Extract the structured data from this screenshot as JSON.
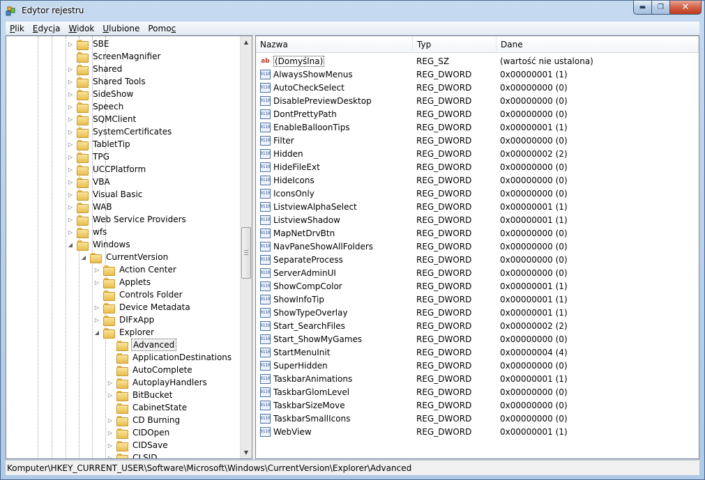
{
  "window": {
    "title": "Edytor rejestru"
  },
  "menu": [
    {
      "pre": "",
      "u": "P",
      "post": "lik"
    },
    {
      "pre": "",
      "u": "E",
      "post": "dycja"
    },
    {
      "pre": "",
      "u": "W",
      "post": "idok"
    },
    {
      "pre": "",
      "u": "U",
      "post": "lubione"
    },
    {
      "pre": "Pomo",
      "u": "c",
      "post": ""
    }
  ],
  "tree": {
    "items": [
      {
        "label": "SBE",
        "level": 1,
        "exp": "collapsed"
      },
      {
        "label": "ScreenMagnifier",
        "level": 1,
        "exp": "none"
      },
      {
        "label": "Shared",
        "level": 1,
        "exp": "collapsed"
      },
      {
        "label": "Shared Tools",
        "level": 1,
        "exp": "collapsed"
      },
      {
        "label": "SideShow",
        "level": 1,
        "exp": "collapsed"
      },
      {
        "label": "Speech",
        "level": 1,
        "exp": "collapsed"
      },
      {
        "label": "SQMClient",
        "level": 1,
        "exp": "collapsed"
      },
      {
        "label": "SystemCertificates",
        "level": 1,
        "exp": "collapsed"
      },
      {
        "label": "TabletTip",
        "level": 1,
        "exp": "collapsed"
      },
      {
        "label": "TPG",
        "level": 1,
        "exp": "collapsed"
      },
      {
        "label": "UCCPlatform",
        "level": 1,
        "exp": "collapsed"
      },
      {
        "label": "VBA",
        "level": 1,
        "exp": "collapsed"
      },
      {
        "label": "Visual Basic",
        "level": 1,
        "exp": "collapsed"
      },
      {
        "label": "WAB",
        "level": 1,
        "exp": "collapsed"
      },
      {
        "label": "Web Service Providers",
        "level": 1,
        "exp": "collapsed"
      },
      {
        "label": "wfs",
        "level": 1,
        "exp": "collapsed"
      },
      {
        "label": "Windows",
        "level": 1,
        "exp": "expanded"
      },
      {
        "label": "CurrentVersion",
        "level": 2,
        "exp": "expanded"
      },
      {
        "label": "Action Center",
        "level": 3,
        "exp": "collapsed"
      },
      {
        "label": "Applets",
        "level": 3,
        "exp": "collapsed"
      },
      {
        "label": "Controls Folder",
        "level": 3,
        "exp": "none"
      },
      {
        "label": "Device Metadata",
        "level": 3,
        "exp": "collapsed"
      },
      {
        "label": "DIFxApp",
        "level": 3,
        "exp": "collapsed"
      },
      {
        "label": "Explorer",
        "level": 3,
        "exp": "expanded"
      },
      {
        "label": "Advanced",
        "level": 4,
        "exp": "none",
        "selected": true
      },
      {
        "label": "ApplicationDestinations",
        "level": 4,
        "exp": "none"
      },
      {
        "label": "AutoComplete",
        "level": 4,
        "exp": "none"
      },
      {
        "label": "AutoplayHandlers",
        "level": 4,
        "exp": "collapsed"
      },
      {
        "label": "BitBucket",
        "level": 4,
        "exp": "collapsed"
      },
      {
        "label": "CabinetState",
        "level": 4,
        "exp": "none"
      },
      {
        "label": "CD Burning",
        "level": 4,
        "exp": "collapsed"
      },
      {
        "label": "CIDOpen",
        "level": 4,
        "exp": "collapsed"
      },
      {
        "label": "CIDSave",
        "level": 4,
        "exp": "collapsed"
      },
      {
        "label": "CLSID",
        "level": 4,
        "exp": "collapsed"
      }
    ]
  },
  "columns": {
    "name": "Nazwa",
    "type": "Typ",
    "data": "Dane"
  },
  "values": [
    {
      "name": "(Domyślna)",
      "type": "REG_SZ",
      "data": "(wartość nie ustalona)",
      "icon": "string-value-icon"
    },
    {
      "name": "AlwaysShowMenus",
      "type": "REG_DWORD",
      "data": "0x00000001 (1)",
      "icon": "binary-value-icon"
    },
    {
      "name": "AutoCheckSelect",
      "type": "REG_DWORD",
      "data": "0x00000000 (0)",
      "icon": "binary-value-icon"
    },
    {
      "name": "DisablePreviewDesktop",
      "type": "REG_DWORD",
      "data": "0x00000000 (0)",
      "icon": "binary-value-icon"
    },
    {
      "name": "DontPrettyPath",
      "type": "REG_DWORD",
      "data": "0x00000000 (0)",
      "icon": "binary-value-icon"
    },
    {
      "name": "EnableBalloonTips",
      "type": "REG_DWORD",
      "data": "0x00000001 (1)",
      "icon": "binary-value-icon"
    },
    {
      "name": "Filter",
      "type": "REG_DWORD",
      "data": "0x00000000 (0)",
      "icon": "binary-value-icon"
    },
    {
      "name": "Hidden",
      "type": "REG_DWORD",
      "data": "0x00000002 (2)",
      "icon": "binary-value-icon"
    },
    {
      "name": "HideFileExt",
      "type": "REG_DWORD",
      "data": "0x00000000 (0)",
      "icon": "binary-value-icon"
    },
    {
      "name": "HideIcons",
      "type": "REG_DWORD",
      "data": "0x00000000 (0)",
      "icon": "binary-value-icon"
    },
    {
      "name": "IconsOnly",
      "type": "REG_DWORD",
      "data": "0x00000000 (0)",
      "icon": "binary-value-icon"
    },
    {
      "name": "ListviewAlphaSelect",
      "type": "REG_DWORD",
      "data": "0x00000001 (1)",
      "icon": "binary-value-icon"
    },
    {
      "name": "ListviewShadow",
      "type": "REG_DWORD",
      "data": "0x00000001 (1)",
      "icon": "binary-value-icon"
    },
    {
      "name": "MapNetDrvBtn",
      "type": "REG_DWORD",
      "data": "0x00000000 (0)",
      "icon": "binary-value-icon"
    },
    {
      "name": "NavPaneShowAllFolders",
      "type": "REG_DWORD",
      "data": "0x00000000 (0)",
      "icon": "binary-value-icon"
    },
    {
      "name": "SeparateProcess",
      "type": "REG_DWORD",
      "data": "0x00000000 (0)",
      "icon": "binary-value-icon"
    },
    {
      "name": "ServerAdminUI",
      "type": "REG_DWORD",
      "data": "0x00000000 (0)",
      "icon": "binary-value-icon"
    },
    {
      "name": "ShowCompColor",
      "type": "REG_DWORD",
      "data": "0x00000001 (1)",
      "icon": "binary-value-icon"
    },
    {
      "name": "ShowInfoTip",
      "type": "REG_DWORD",
      "data": "0x00000001 (1)",
      "icon": "binary-value-icon"
    },
    {
      "name": "ShowTypeOverlay",
      "type": "REG_DWORD",
      "data": "0x00000001 (1)",
      "icon": "binary-value-icon"
    },
    {
      "name": "Start_SearchFiles",
      "type": "REG_DWORD",
      "data": "0x00000002 (2)",
      "icon": "binary-value-icon"
    },
    {
      "name": "Start_ShowMyGames",
      "type": "REG_DWORD",
      "data": "0x00000000 (0)",
      "icon": "binary-value-icon"
    },
    {
      "name": "StartMenuInit",
      "type": "REG_DWORD",
      "data": "0x00000004 (4)",
      "icon": "binary-value-icon"
    },
    {
      "name": "SuperHidden",
      "type": "REG_DWORD",
      "data": "0x00000000 (0)",
      "icon": "binary-value-icon"
    },
    {
      "name": "TaskbarAnimations",
      "type": "REG_DWORD",
      "data": "0x00000001 (1)",
      "icon": "binary-value-icon"
    },
    {
      "name": "TaskbarGlomLevel",
      "type": "REG_DWORD",
      "data": "0x00000000 (0)",
      "icon": "binary-value-icon"
    },
    {
      "name": "TaskbarSizeMove",
      "type": "REG_DWORD",
      "data": "0x00000000 (0)",
      "icon": "binary-value-icon"
    },
    {
      "name": "TaskbarSmallIcons",
      "type": "REG_DWORD",
      "data": "0x00000000 (0)",
      "icon": "binary-value-icon"
    },
    {
      "name": "WebView",
      "type": "REG_DWORD",
      "data": "0x00000001 (1)",
      "icon": "binary-value-icon"
    }
  ],
  "status": {
    "path": "Komputer\\HKEY_CURRENT_USER\\Software\\Microsoft\\Windows\\CurrentVersion\\Explorer\\Advanced"
  },
  "colors": {
    "window_frame": "#b8cfe9",
    "close_button": "#c1391c",
    "selection_frame": "#5a5a5a",
    "folder": "#e8bd4d"
  }
}
